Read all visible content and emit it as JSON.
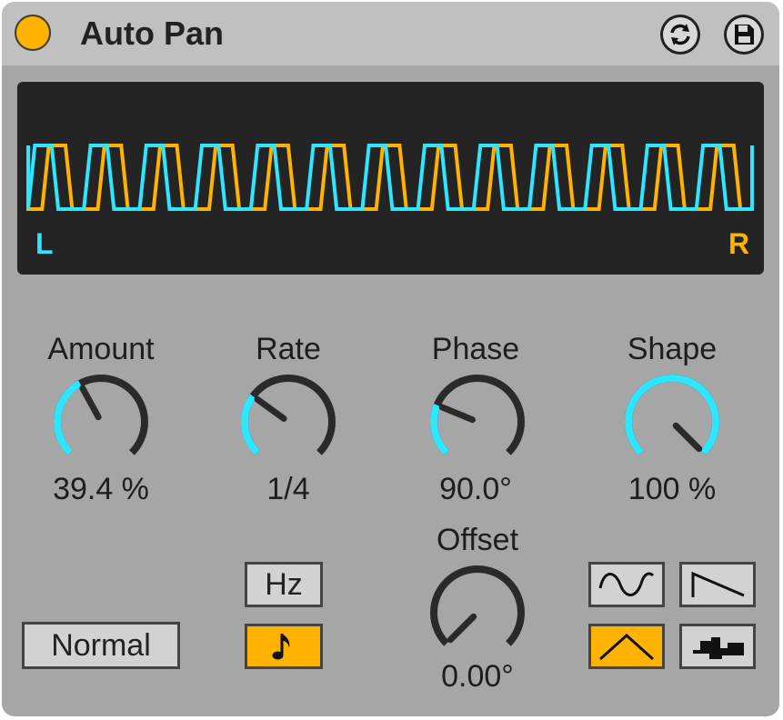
{
  "device": {
    "title": "Auto Pan",
    "power_on": true,
    "hot_swap_icon": "hot-swap-icon",
    "save_icon": "save-preset-icon"
  },
  "display": {
    "left_label": "L",
    "right_label": "R",
    "left_color": "#2ee6ff",
    "right_color": "#ffb300"
  },
  "knobs": {
    "amount": {
      "label": "Amount",
      "value": "39.4 %",
      "fraction": 0.394
    },
    "rate": {
      "label": "Rate",
      "value": "1/4"
    },
    "phase": {
      "label": "Phase",
      "value": "90.0°",
      "fraction": 0.25
    },
    "shape": {
      "label": "Shape",
      "value": "100 %",
      "fraction": 1.0
    },
    "offset": {
      "label": "Offset",
      "value": "0.00°",
      "fraction": 0.0
    }
  },
  "buttons": {
    "hz_label": "Hz",
    "sync_icon": "note-icon",
    "mode_label": "Normal"
  },
  "waveforms": [
    {
      "name": "sine-wave-icon",
      "active": false
    },
    {
      "name": "sawtooth-down-icon",
      "active": false
    },
    {
      "name": "triangle-wave-icon",
      "active": true
    },
    {
      "name": "random-wave-icon",
      "active": false
    }
  ],
  "colors": {
    "accent_cyan": "#2ee6ff",
    "accent_orange": "#ffb300",
    "panel": "#a6a6a6"
  }
}
